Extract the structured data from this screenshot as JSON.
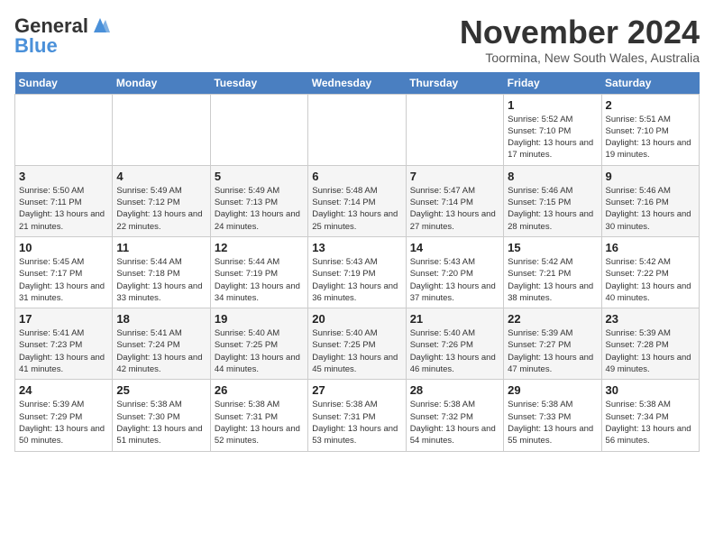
{
  "logo": {
    "line1": "General",
    "line2": "Blue"
  },
  "title": "November 2024",
  "location": "Toormina, New South Wales, Australia",
  "days_header": [
    "Sunday",
    "Monday",
    "Tuesday",
    "Wednesday",
    "Thursday",
    "Friday",
    "Saturday"
  ],
  "weeks": [
    [
      {
        "day": "",
        "info": ""
      },
      {
        "day": "",
        "info": ""
      },
      {
        "day": "",
        "info": ""
      },
      {
        "day": "",
        "info": ""
      },
      {
        "day": "",
        "info": ""
      },
      {
        "day": "1",
        "info": "Sunrise: 5:52 AM\nSunset: 7:10 PM\nDaylight: 13 hours\nand 17 minutes."
      },
      {
        "day": "2",
        "info": "Sunrise: 5:51 AM\nSunset: 7:10 PM\nDaylight: 13 hours\nand 19 minutes."
      }
    ],
    [
      {
        "day": "3",
        "info": "Sunrise: 5:50 AM\nSunset: 7:11 PM\nDaylight: 13 hours\nand 21 minutes."
      },
      {
        "day": "4",
        "info": "Sunrise: 5:49 AM\nSunset: 7:12 PM\nDaylight: 13 hours\nand 22 minutes."
      },
      {
        "day": "5",
        "info": "Sunrise: 5:49 AM\nSunset: 7:13 PM\nDaylight: 13 hours\nand 24 minutes."
      },
      {
        "day": "6",
        "info": "Sunrise: 5:48 AM\nSunset: 7:14 PM\nDaylight: 13 hours\nand 25 minutes."
      },
      {
        "day": "7",
        "info": "Sunrise: 5:47 AM\nSunset: 7:14 PM\nDaylight: 13 hours\nand 27 minutes."
      },
      {
        "day": "8",
        "info": "Sunrise: 5:46 AM\nSunset: 7:15 PM\nDaylight: 13 hours\nand 28 minutes."
      },
      {
        "day": "9",
        "info": "Sunrise: 5:46 AM\nSunset: 7:16 PM\nDaylight: 13 hours\nand 30 minutes."
      }
    ],
    [
      {
        "day": "10",
        "info": "Sunrise: 5:45 AM\nSunset: 7:17 PM\nDaylight: 13 hours\nand 31 minutes."
      },
      {
        "day": "11",
        "info": "Sunrise: 5:44 AM\nSunset: 7:18 PM\nDaylight: 13 hours\nand 33 minutes."
      },
      {
        "day": "12",
        "info": "Sunrise: 5:44 AM\nSunset: 7:19 PM\nDaylight: 13 hours\nand 34 minutes."
      },
      {
        "day": "13",
        "info": "Sunrise: 5:43 AM\nSunset: 7:19 PM\nDaylight: 13 hours\nand 36 minutes."
      },
      {
        "day": "14",
        "info": "Sunrise: 5:43 AM\nSunset: 7:20 PM\nDaylight: 13 hours\nand 37 minutes."
      },
      {
        "day": "15",
        "info": "Sunrise: 5:42 AM\nSunset: 7:21 PM\nDaylight: 13 hours\nand 38 minutes."
      },
      {
        "day": "16",
        "info": "Sunrise: 5:42 AM\nSunset: 7:22 PM\nDaylight: 13 hours\nand 40 minutes."
      }
    ],
    [
      {
        "day": "17",
        "info": "Sunrise: 5:41 AM\nSunset: 7:23 PM\nDaylight: 13 hours\nand 41 minutes."
      },
      {
        "day": "18",
        "info": "Sunrise: 5:41 AM\nSunset: 7:24 PM\nDaylight: 13 hours\nand 42 minutes."
      },
      {
        "day": "19",
        "info": "Sunrise: 5:40 AM\nSunset: 7:25 PM\nDaylight: 13 hours\nand 44 minutes."
      },
      {
        "day": "20",
        "info": "Sunrise: 5:40 AM\nSunset: 7:25 PM\nDaylight: 13 hours\nand 45 minutes."
      },
      {
        "day": "21",
        "info": "Sunrise: 5:40 AM\nSunset: 7:26 PM\nDaylight: 13 hours\nand 46 minutes."
      },
      {
        "day": "22",
        "info": "Sunrise: 5:39 AM\nSunset: 7:27 PM\nDaylight: 13 hours\nand 47 minutes."
      },
      {
        "day": "23",
        "info": "Sunrise: 5:39 AM\nSunset: 7:28 PM\nDaylight: 13 hours\nand 49 minutes."
      }
    ],
    [
      {
        "day": "24",
        "info": "Sunrise: 5:39 AM\nSunset: 7:29 PM\nDaylight: 13 hours\nand 50 minutes."
      },
      {
        "day": "25",
        "info": "Sunrise: 5:38 AM\nSunset: 7:30 PM\nDaylight: 13 hours\nand 51 minutes."
      },
      {
        "day": "26",
        "info": "Sunrise: 5:38 AM\nSunset: 7:31 PM\nDaylight: 13 hours\nand 52 minutes."
      },
      {
        "day": "27",
        "info": "Sunrise: 5:38 AM\nSunset: 7:31 PM\nDaylight: 13 hours\nand 53 minutes."
      },
      {
        "day": "28",
        "info": "Sunrise: 5:38 AM\nSunset: 7:32 PM\nDaylight: 13 hours\nand 54 minutes."
      },
      {
        "day": "29",
        "info": "Sunrise: 5:38 AM\nSunset: 7:33 PM\nDaylight: 13 hours\nand 55 minutes."
      },
      {
        "day": "30",
        "info": "Sunrise: 5:38 AM\nSunset: 7:34 PM\nDaylight: 13 hours\nand 56 minutes."
      }
    ]
  ]
}
